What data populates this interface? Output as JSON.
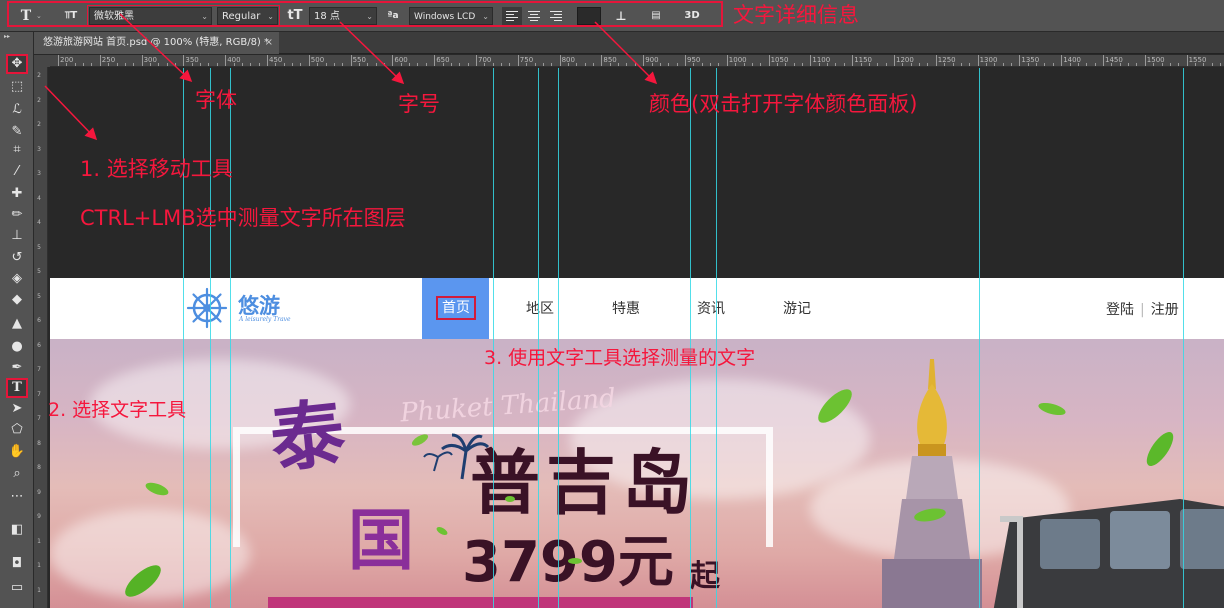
{
  "options_bar": {
    "tool_icon": "T",
    "orientation_icon": "text-orientation-icon",
    "font_family": "微软雅黑",
    "font_style": "Regular",
    "font_size_icon": "tT",
    "font_size": "18 点",
    "aa_icon": "ªa",
    "antialias": "Windows LCD",
    "align_left": "align-left-icon",
    "align_center": "align-center-icon",
    "align_right": "align-right-icon",
    "warp_icon": "warp-text-icon",
    "panel_icon": "character-panel-icon",
    "threed_label": "3D"
  },
  "document_tab": {
    "title": "悠游旅游网站 首页.psd @ 100% (特惠, RGB/8) *",
    "close": "×"
  },
  "ruler_h_labels": [
    "200",
    "250",
    "300",
    "350",
    "400",
    "450",
    "500",
    "550",
    "600",
    "650",
    "700",
    "750",
    "800",
    "850",
    "900",
    "950",
    "1000",
    "1050",
    "1100",
    "1150",
    "1200",
    "1250",
    "1300",
    "1350",
    "1400",
    "1450",
    "1500",
    "1550"
  ],
  "ruler_v_labels": [
    "2",
    "2",
    "2",
    "3",
    "3",
    "4",
    "4",
    "5",
    "5",
    "5",
    "6",
    "6",
    "7",
    "7",
    "7",
    "8",
    "8",
    "9",
    "9",
    "1",
    "1",
    "1"
  ],
  "toolbar": {
    "tools": [
      {
        "name": "move-tool",
        "glyph": "✥"
      },
      {
        "name": "marquee-tool",
        "glyph": "⬚"
      },
      {
        "name": "lasso-tool",
        "glyph": "ℒ"
      },
      {
        "name": "quick-select-tool",
        "glyph": "✎"
      },
      {
        "name": "crop-tool",
        "glyph": "⌗"
      },
      {
        "name": "eyedropper-tool",
        "glyph": "⁄"
      },
      {
        "name": "healing-tool",
        "glyph": "✚"
      },
      {
        "name": "brush-tool",
        "glyph": "✏"
      },
      {
        "name": "stamp-tool",
        "glyph": "⊥"
      },
      {
        "name": "history-brush-tool",
        "glyph": "↺"
      },
      {
        "name": "eraser-tool",
        "glyph": "◈"
      },
      {
        "name": "paint-bucket-tool",
        "glyph": "◆"
      },
      {
        "name": "blur-tool",
        "glyph": "▲"
      },
      {
        "name": "dodge-tool",
        "glyph": "●"
      },
      {
        "name": "pen-tool",
        "glyph": "✒"
      },
      {
        "name": "type-tool",
        "glyph": "T"
      },
      {
        "name": "path-select-tool",
        "glyph": "➤"
      },
      {
        "name": "shape-tool",
        "glyph": "⬠"
      },
      {
        "name": "hand-tool",
        "glyph": "✋"
      },
      {
        "name": "zoom-tool",
        "glyph": "⌕"
      },
      {
        "name": "more-tools",
        "glyph": "⋯"
      },
      {
        "name": "color-swatches",
        "glyph": "◧"
      },
      {
        "name": "quick-mask",
        "glyph": "◘"
      },
      {
        "name": "screen-mode",
        "glyph": "▭"
      }
    ]
  },
  "website": {
    "logo_name": "悠游",
    "logo_slogan": "A leisurely Trave",
    "nav": [
      "首页",
      "地区",
      "特惠",
      "资讯",
      "游记"
    ],
    "login": "登陆",
    "register": "注册",
    "banner": {
      "tai": "泰",
      "guo": "国",
      "phuket": "Phuket Thailand",
      "title": "普吉岛",
      "price": "3799元",
      "qi": "起"
    }
  },
  "annotations": {
    "details": "文字详细信息",
    "font": "字体",
    "size": "字号",
    "color": "颜色(双击打开字体颜色面板)",
    "step1": "1. 选择移动工具",
    "step1b": "CTRL+LMB选中测量文字所在图层",
    "step2": "2. 选择文字工具",
    "step3": "3. 使用文字工具选择测量的文字"
  },
  "colors": {
    "annotation_red": "#f5173d",
    "guide_cyan": "#34d9e6",
    "nav_active_bg": "#5b96ef",
    "logo_blue": "#4d8ee0"
  }
}
